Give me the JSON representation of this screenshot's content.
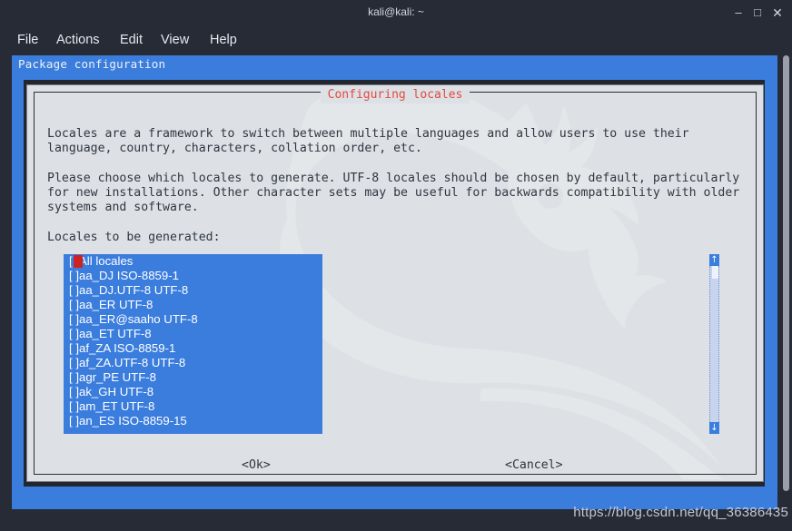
{
  "window": {
    "title": "kali@kali: ~",
    "controls": {
      "minimize": "–",
      "maximize": "□",
      "close": "✕"
    }
  },
  "menubar": {
    "items": [
      {
        "label": "File"
      },
      {
        "label": "Actions"
      },
      {
        "label": "Edit"
      },
      {
        "label": "View"
      },
      {
        "label": "Help"
      }
    ]
  },
  "dialog": {
    "backtitle": "Package configuration",
    "title": "Configuring locales",
    "title_color": "#e04a3f",
    "accent_color": "#3b7ddd",
    "paragraph1": "Locales are a framework to switch between multiple languages and allow users to use their\nlanguage, country, characters, collation order, etc.",
    "paragraph2": "Please choose which locales to generate. UTF-8 locales should be chosen by default, particularly\nfor new installations. Other character sets may be useful for backwards compatibility with older\nsystems and software.",
    "list_label": "Locales to be generated:",
    "locales": [
      {
        "checkbox": "[ ]",
        "label": "All locales",
        "checked": false,
        "cursor": true
      },
      {
        "checkbox": "[ ]",
        "label": "aa_DJ ISO-8859-1",
        "checked": false,
        "cursor": false
      },
      {
        "checkbox": "[ ]",
        "label": "aa_DJ.UTF-8 UTF-8",
        "checked": false,
        "cursor": false
      },
      {
        "checkbox": "[ ]",
        "label": "aa_ER UTF-8",
        "checked": false,
        "cursor": false
      },
      {
        "checkbox": "[ ]",
        "label": "aa_ER@saaho UTF-8",
        "checked": false,
        "cursor": false
      },
      {
        "checkbox": "[ ]",
        "label": "aa_ET UTF-8",
        "checked": false,
        "cursor": false
      },
      {
        "checkbox": "[ ]",
        "label": "af_ZA ISO-8859-1",
        "checked": false,
        "cursor": false
      },
      {
        "checkbox": "[ ]",
        "label": "af_ZA.UTF-8 UTF-8",
        "checked": false,
        "cursor": false
      },
      {
        "checkbox": "[ ]",
        "label": "agr_PE UTF-8",
        "checked": false,
        "cursor": false
      },
      {
        "checkbox": "[ ]",
        "label": "ak_GH UTF-8",
        "checked": false,
        "cursor": false
      },
      {
        "checkbox": "[ ]",
        "label": "am_ET UTF-8",
        "checked": false,
        "cursor": false
      },
      {
        "checkbox": "[ ]",
        "label": "an_ES ISO-8859-15",
        "checked": false,
        "cursor": false
      }
    ],
    "scrollbar": {
      "up_arrow": "↑",
      "down_arrow": "↓"
    },
    "buttons": {
      "ok": "<Ok>",
      "cancel": "<Cancel>"
    }
  },
  "watermark": "https://blog.csdn.net/qq_36386435"
}
